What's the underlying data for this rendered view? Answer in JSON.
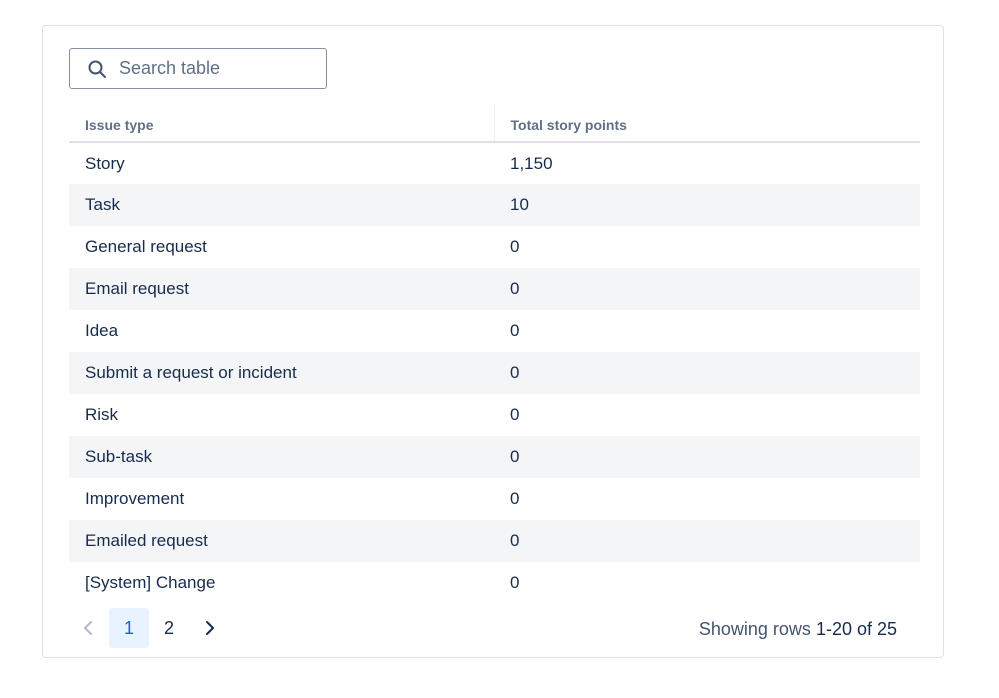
{
  "search": {
    "placeholder": "Search table",
    "value": ""
  },
  "table": {
    "headers": [
      "Issue type",
      "Total story points"
    ],
    "rows": [
      [
        "Story",
        "1,150"
      ],
      [
        "Task",
        "10"
      ],
      [
        "General request",
        "0"
      ],
      [
        "Email request",
        "0"
      ],
      [
        "Idea",
        "0"
      ],
      [
        "Submit a request or incident",
        "0"
      ],
      [
        "Risk",
        "0"
      ],
      [
        "Sub-task",
        "0"
      ],
      [
        "Improvement",
        "0"
      ],
      [
        "Emailed request",
        "0"
      ],
      [
        "[System] Change",
        "0"
      ]
    ]
  },
  "pagination": {
    "pages": [
      "1",
      "2"
    ],
    "current_page": "1",
    "status_prefix": "Showing rows",
    "status_range": "1-20 of 25"
  },
  "icons": {
    "search": "search-icon",
    "prev": "chevron-left-icon",
    "next": "chevron-right-icon"
  },
  "colors": {
    "accent": "#0c66e4",
    "active_page_bg": "#e9f2ff",
    "stripe": "#f4f5f7"
  }
}
